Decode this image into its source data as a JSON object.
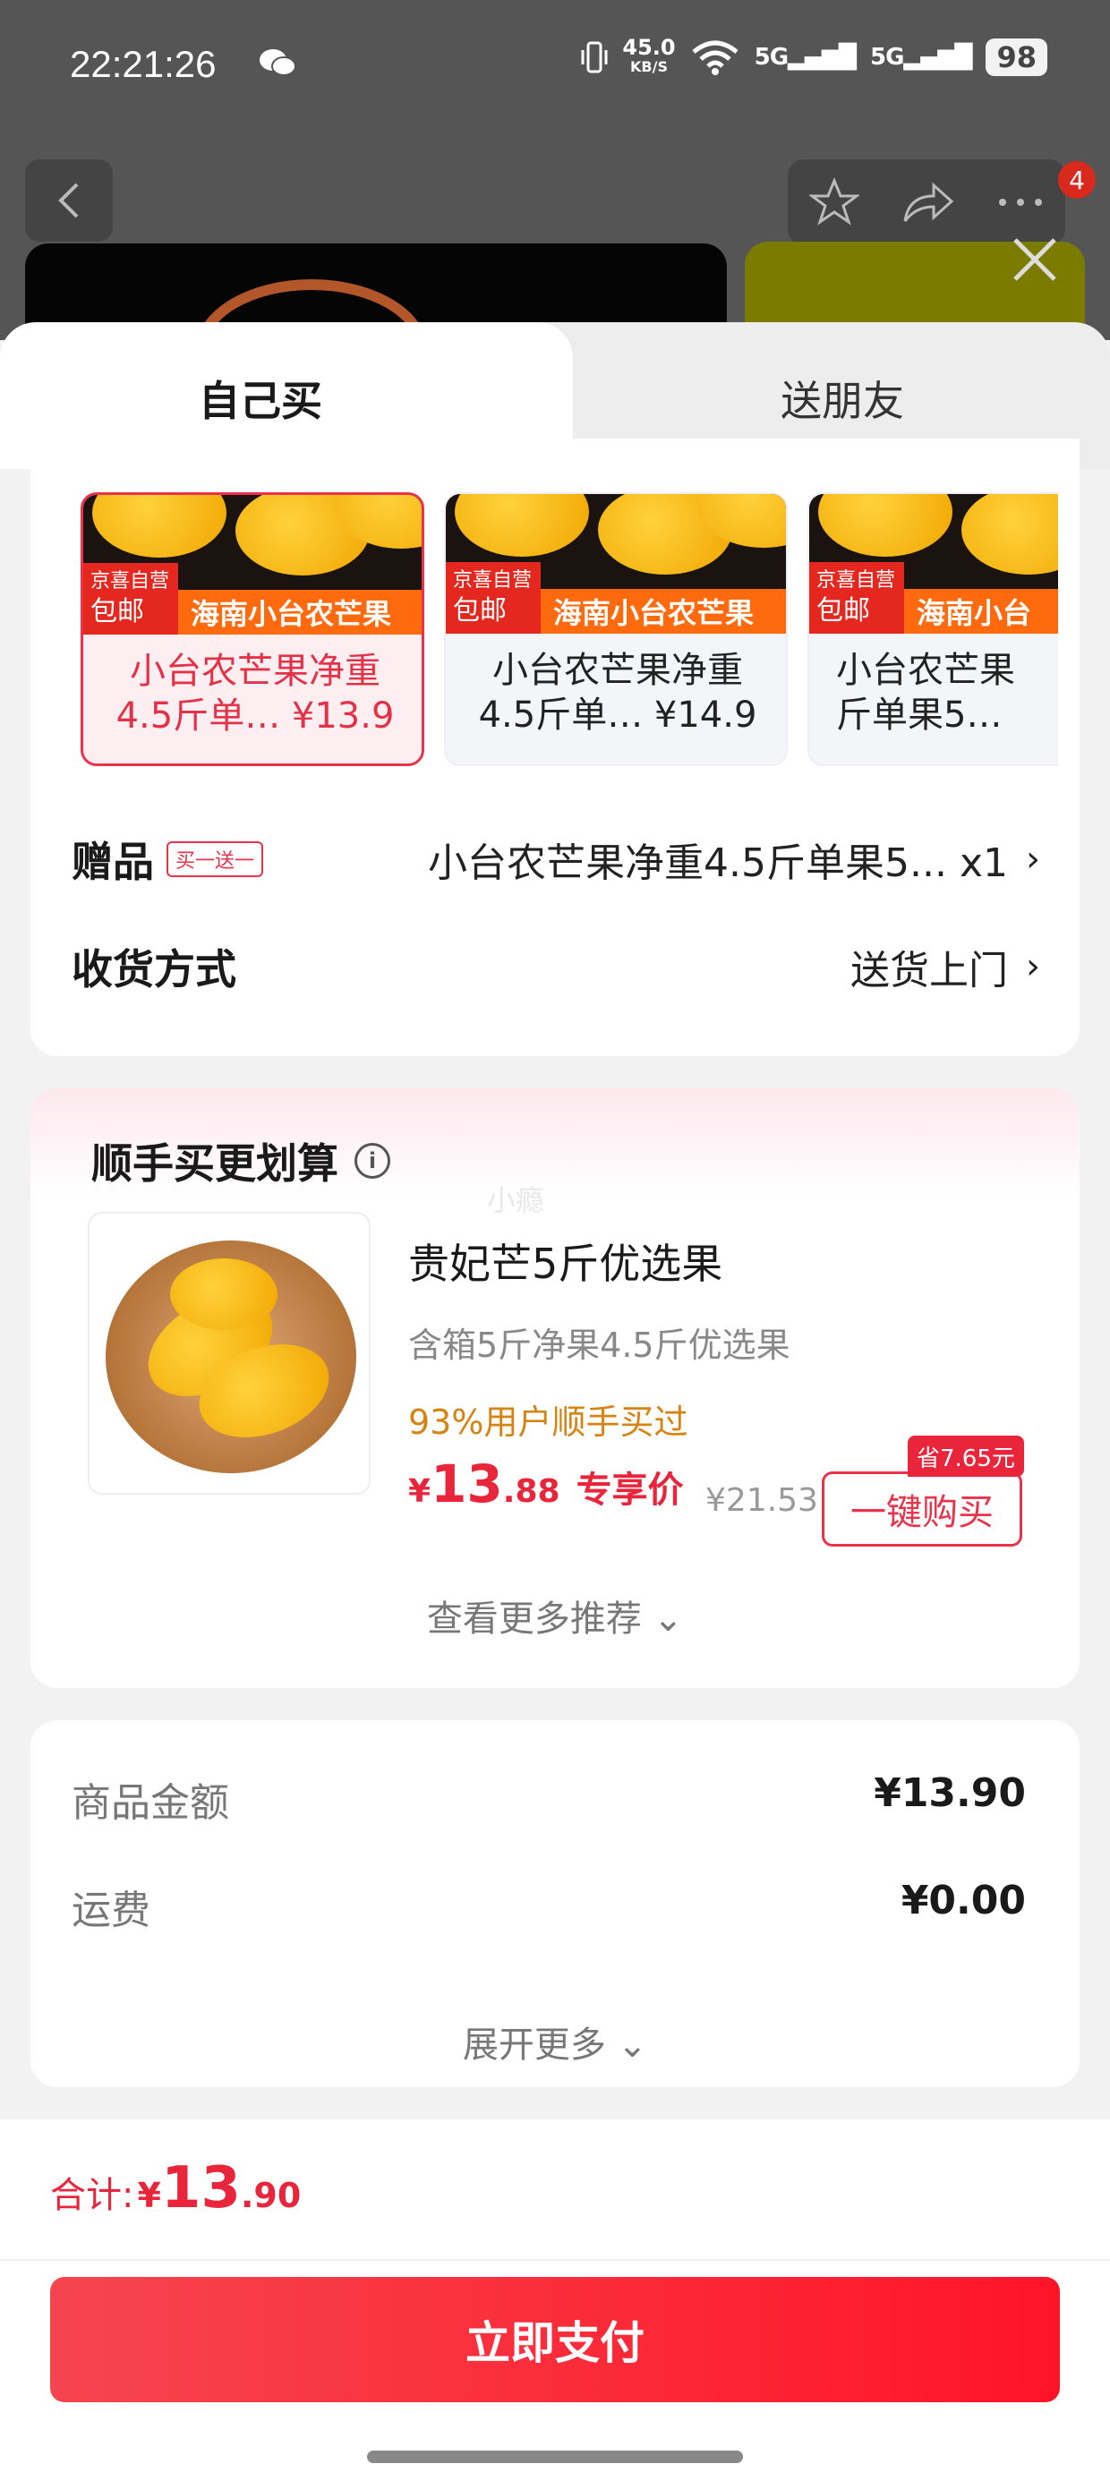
{
  "status_bar": {
    "time": "22:21:26",
    "net_speed_value": "45.0",
    "net_speed_unit": "KB/S",
    "signal_1": "5G",
    "signal_2": "5G",
    "battery": "98"
  },
  "background": {
    "cart_badge_count": "4"
  },
  "tabs": {
    "self": "自己买",
    "gift": "送朋友"
  },
  "sku_options": [
    {
      "tag_brand": "京喜自营",
      "tag_shipping": "包邮",
      "banner": "海南小台农芒果",
      "name_line1": "小台农芒果净重",
      "name_line2": "4.5斤单… ¥13.9",
      "selected": true
    },
    {
      "tag_brand": "京喜自营",
      "tag_shipping": "包邮",
      "banner": "海南小台农芒果",
      "name_line1": "小台农芒果净重",
      "name_line2": "4.5斤单… ¥14.9",
      "selected": false
    },
    {
      "tag_brand": "京喜自营",
      "tag_shipping": "包邮",
      "banner": "海南小台",
      "name_line1": "小台农芒果",
      "name_line2": "斤单果5…",
      "selected": false
    }
  ],
  "gift_row": {
    "label": "赠品",
    "badge": "买一送一",
    "value": "小台农芒果净重4.5斤单果5... x1"
  },
  "delivery_row": {
    "label": "收货方式",
    "value": "送货上门"
  },
  "recommend": {
    "title": "顺手买更划算",
    "watermark": "小瘾",
    "product_name": "贵妃芒5斤优选果",
    "product_desc": "含箱5斤净果4.5斤优选果",
    "social_proof": "93%用户顺手买过",
    "price_yen": "¥",
    "price_int": "13",
    "price_dec": ".88",
    "price_tag": "专享价",
    "original_price": "¥21.53",
    "save_badge": "省7.65元",
    "buy_button": "一键购买",
    "see_more": "查看更多推荐"
  },
  "summary": {
    "goods_label": "商品金额",
    "goods_value": "¥13.90",
    "shipping_label": "运费",
    "shipping_value": "¥0.00",
    "expand": "展开更多"
  },
  "footer": {
    "total_label": "合计:",
    "total_yen": "¥",
    "total_int": "13",
    "total_dec": ".90",
    "pay_button": "立即支付"
  }
}
